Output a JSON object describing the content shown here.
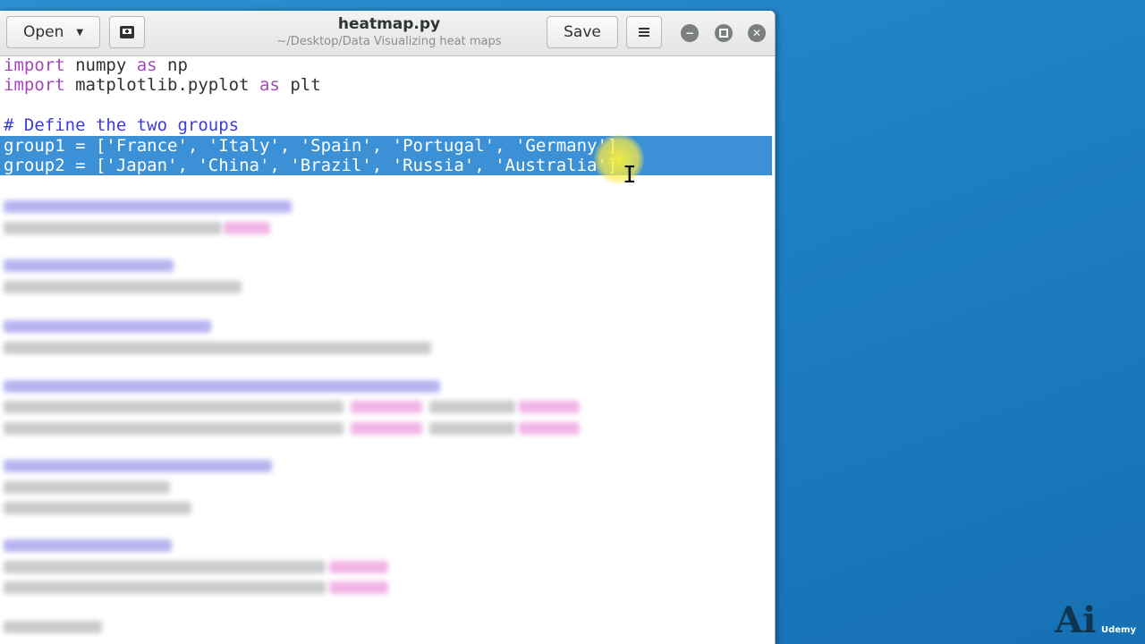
{
  "window": {
    "title": "heatmap.py",
    "subtitle": "~/Desktop/Data Visualizing heat maps",
    "open_label": "Open",
    "save_label": "Save"
  },
  "code": {
    "line1": {
      "kw1": "import",
      "mid": " numpy ",
      "kw2": "as",
      "end": " np"
    },
    "line2": {
      "kw1": "import",
      "mid": " matplotlib.pyplot ",
      "kw2": "as",
      "end": " plt"
    },
    "comment1": "# Define the two groups",
    "group1": "group1 = ['France', 'Italy', 'Spain', 'Portugal', 'Germany']",
    "group2": "group2 = ['Japan', 'China', 'Brazil', 'Russia', 'Australia']"
  },
  "watermark": {
    "mark": "Ai",
    "brand": "Udemy"
  },
  "colors": {
    "selection": "#3b90d6",
    "keyword": "#a347ba",
    "comment": "#3d3dd4",
    "desktop": "#1e7fc4"
  }
}
